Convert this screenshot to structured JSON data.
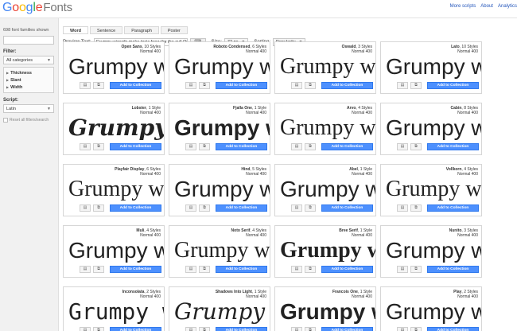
{
  "header": {
    "logo_google": "Google",
    "logo_fonts": "Fonts",
    "nav": [
      "More scripts",
      "About",
      "Analytics"
    ]
  },
  "sidebar": {
    "count": "698 font families shown",
    "filter_label": "Filter:",
    "category_value": "All categories",
    "facets": [
      "Thickness",
      "Slant",
      "Width"
    ],
    "script_label": "Script:",
    "script_value": "Latin",
    "reset": "Reset all filters/search"
  },
  "tabs": [
    {
      "label": "Word",
      "active": true
    },
    {
      "label": "Sentence",
      "active": false
    },
    {
      "label": "Paragraph",
      "active": false
    },
    {
      "label": "Poster",
      "active": false
    }
  ],
  "controls": {
    "preview_label": "Preview Text:",
    "preview_value": "Grumpy wizards make toxic brew for the evil Queen and Jack.",
    "size_label": "Size:",
    "size_value": "72 px",
    "sorting_label": "Sorting:",
    "sorting_value": "Popularity"
  },
  "card_labels": {
    "add": "Add to Collection",
    "weight": "Normal 400"
  },
  "fonts": [
    {
      "name": "Open Sans",
      "styles": "10 Styles",
      "sample": "Grumpy wiz"
    },
    {
      "name": "Roboto Condensed",
      "styles": "6 Styles",
      "sample": "Grumpy wizard"
    },
    {
      "name": "Oswald",
      "styles": "3 Styles",
      "sample": "Grumpy w"
    },
    {
      "name": "Lato",
      "styles": "10 Styles",
      "sample": "Grumpy w"
    },
    {
      "name": "Lobster",
      "styles": "1 Style",
      "sample": "Grumpy wiz"
    },
    {
      "name": "Fjalla One",
      "styles": "1 Style",
      "sample": "Grumpy wiz"
    },
    {
      "name": "Arvo",
      "styles": "4 Styles",
      "sample": "Grumpy w"
    },
    {
      "name": "Cabin",
      "styles": "8 Styles",
      "sample": "Grumpy wi"
    },
    {
      "name": "Playfair Display",
      "styles": "6 Styles",
      "sample": "Grumpy w"
    },
    {
      "name": "Hind",
      "styles": "5 Styles",
      "sample": "Grumpy wiz"
    },
    {
      "name": "Abel",
      "styles": "1 Style",
      "sample": "Grumpy wiz"
    },
    {
      "name": "Vollkorn",
      "styles": "4 Styles",
      "sample": "Grumpy w"
    },
    {
      "name": "Muli",
      "styles": "4 Styles",
      "sample": "Grumpy w"
    },
    {
      "name": "Noto Serif",
      "styles": "4 Styles",
      "sample": "Grumpy w"
    },
    {
      "name": "Bree Serif",
      "styles": "1 Style",
      "sample": "Grumpy w"
    },
    {
      "name": "Nunito",
      "styles": "3 Styles",
      "sample": "Grumpy w"
    },
    {
      "name": "Inconsolata",
      "styles": "2 Styles",
      "sample": "Grumpy wi:"
    },
    {
      "name": "Shadows Into Light",
      "styles": "1 Style",
      "sample": "Grumpy wiza"
    },
    {
      "name": "Francois One",
      "styles": "1 Style",
      "sample": "Grumpy wi"
    },
    {
      "name": "Play",
      "styles": "2 Styles",
      "sample": "Grumpy w"
    }
  ]
}
